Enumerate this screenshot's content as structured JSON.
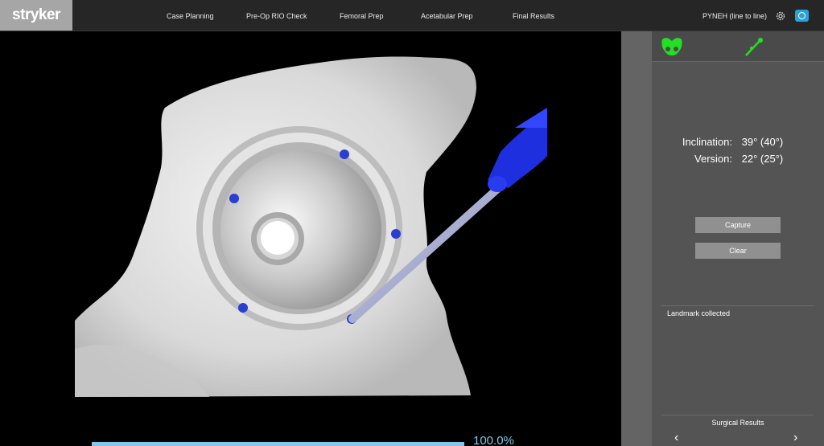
{
  "brand": {
    "logo_text": "stryker"
  },
  "nav": {
    "tabs": [
      {
        "label": "Case Planning"
      },
      {
        "label": "Pre-Op RIO Check"
      },
      {
        "label": "Femoral Prep"
      },
      {
        "label": "Acetabular Prep"
      },
      {
        "label": "Final Results"
      }
    ],
    "user_label": "PYNEH (line to line)"
  },
  "icons": {
    "settings": "gear-icon",
    "camera": "camera-icon",
    "pelvis": "pelvis-icon",
    "probe": "probe-tool-icon"
  },
  "colors": {
    "accent": "#29a3d6",
    "status_green": "#22e022",
    "probe_blue": "#1e2fe0",
    "panel_bg": "#545454"
  },
  "viewport": {
    "progress_label": "100.0%",
    "progress_value": 1.0
  },
  "panel": {
    "inclination_label": "Inclination:",
    "inclination_value": "39° (40°)",
    "version_label": "Version:",
    "version_value": "22° (25°)",
    "capture_label": "Capture",
    "clear_label": "Clear",
    "status_text": "Landmark collected",
    "results_title": "Surgical Results",
    "prev_arrow": "‹",
    "next_arrow": "›"
  }
}
